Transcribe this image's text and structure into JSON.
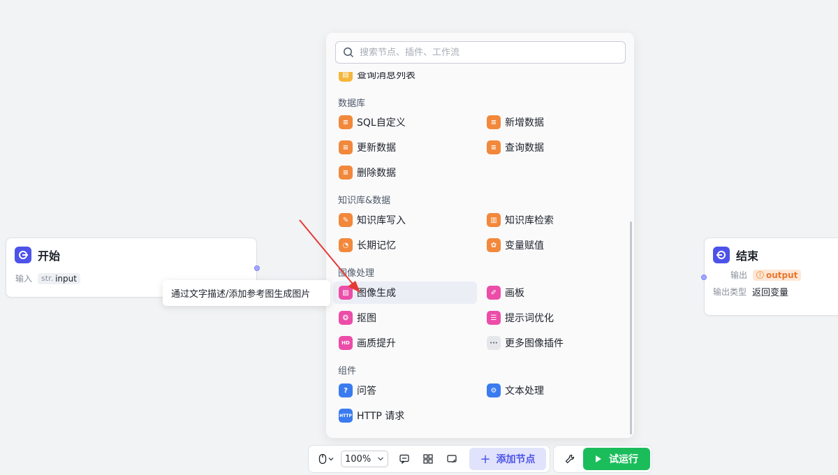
{
  "start_node": {
    "title": "开始",
    "input_label": "输入",
    "param_type": "str.",
    "param_name": "input"
  },
  "end_node": {
    "title": "结束",
    "output_label": "输出",
    "output_name": "output",
    "output_type_label": "输出类型",
    "output_type_value": "返回变量"
  },
  "tooltip": "通过文字描述/添加参考图生成图片",
  "panel": {
    "search_placeholder": "搜索节点、插件、工作流",
    "partial_item": "查询消息列表",
    "sections": {
      "database": "数据库",
      "knowledge": "知识库&数据",
      "image": "图像处理",
      "component": "组件"
    },
    "items": {
      "sql_custom": "SQL自定义",
      "add_data": "新增数据",
      "update_data": "更新数据",
      "query_data": "查询数据",
      "delete_data": "删除数据",
      "kb_write": "知识库写入",
      "kb_search": "知识库检索",
      "long_memory": "长期记忆",
      "var_assign": "变量赋值",
      "image_gen": "图像生成",
      "canvas": "画板",
      "cutout": "抠图",
      "prompt_opt": "提示词优化",
      "quality_up": "画质提升",
      "more_image_plugins": "更多图像插件",
      "qa": "问答",
      "text_process": "文本处理",
      "http_request": "HTTP 请求"
    }
  },
  "toolbar": {
    "zoom": "100%",
    "add_node": "添加节点",
    "run": "试运行"
  },
  "colors": {
    "accent": "#4d53e8",
    "run_green": "#1bbd5b",
    "orange_icon": "#f2883b",
    "pink_icon": "#ec4da8",
    "blue_icon": "#3a7bf0",
    "arrow_red": "#e53935"
  }
}
